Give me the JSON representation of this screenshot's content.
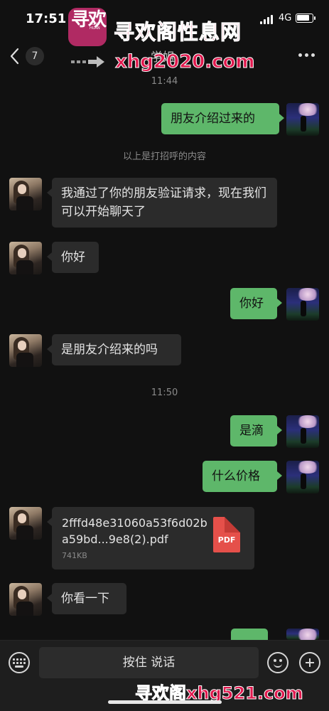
{
  "status_bar": {
    "time": "17:51",
    "network": "4G"
  },
  "watermark": {
    "logo_glyph": "寻欢",
    "logo_sub": "XUN HUAN",
    "title": "寻欢阁性息网",
    "url": "xhg2020.com",
    "bottom": "寻欢阁xhg521.com"
  },
  "nav": {
    "unread_count": "7",
    "title": "学姐"
  },
  "chat": {
    "timestamps": [
      "11:44",
      "11:50"
    ],
    "system_note": "以上是打招呼的内容",
    "messages": [
      {
        "side": "right",
        "text": "朋友介绍过来的"
      },
      {
        "side": "left",
        "text": "我通过了你的朋友验证请求，现在我们可以开始聊天了"
      },
      {
        "side": "left",
        "text": "你好"
      },
      {
        "side": "right",
        "text": "你好"
      },
      {
        "side": "left",
        "text": "是朋友介绍来的吗"
      },
      {
        "side": "right",
        "text": "是滴"
      },
      {
        "side": "right",
        "text": "什么价格"
      },
      {
        "side": "left",
        "type": "file",
        "file_name": "2fffd48e31060a53f6d02ba59bd...9e8(2).pdf",
        "file_size": "741KB",
        "file_type": "PDF"
      },
      {
        "side": "left",
        "text": "你看一下"
      }
    ]
  },
  "input_bar": {
    "voice_label": "按住 说话"
  },
  "icons": {
    "keyboard": "keyboard-icon",
    "emoji": "emoji-icon",
    "plus": "plus-icon",
    "back": "back-chevron-icon",
    "more": "more-icon",
    "pdf": "pdf-file-icon"
  },
  "colors": {
    "background": "#111111",
    "bubble_left": "#2b2b2b",
    "bubble_right": "#5eb76a",
    "watermark": "#e0194e"
  }
}
